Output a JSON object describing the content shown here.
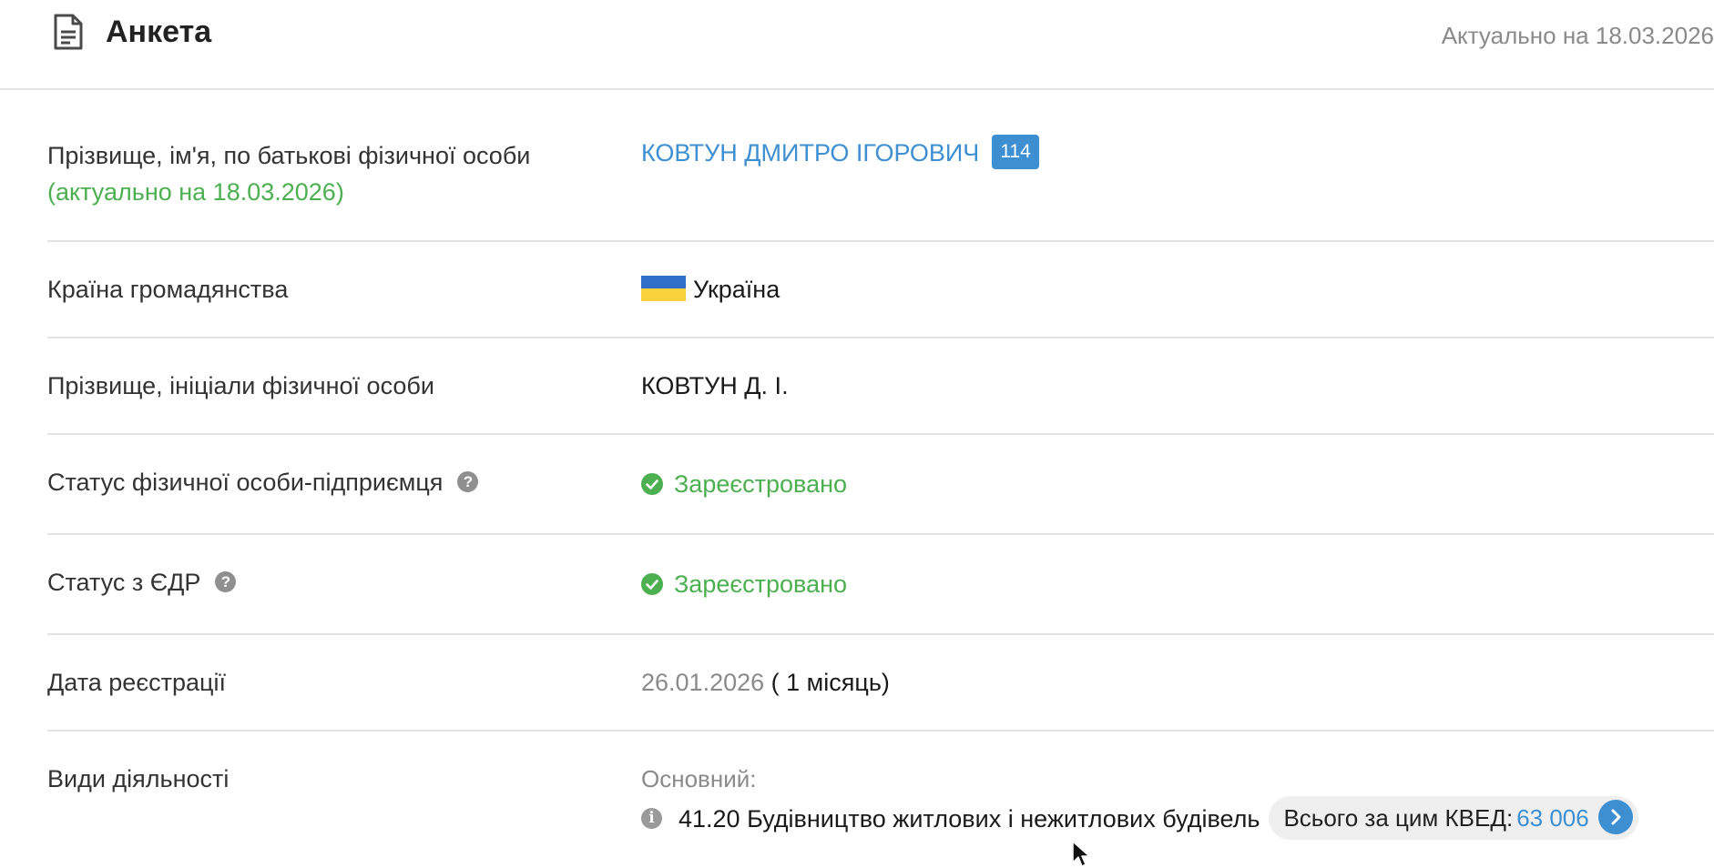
{
  "header": {
    "title": "Анкета",
    "actual_date": "Актуально на 18.03.2026"
  },
  "rows": {
    "full_name": {
      "label": "Прізвище, ім'я, по батькові фізичної особи",
      "label_note": "(актуально на 18.03.2026)",
      "value": "КОВТУН ДМИТРО ІГОРОВИЧ",
      "badge": "114"
    },
    "citizenship": {
      "label": "Країна громадянства",
      "value": "Україна"
    },
    "initials": {
      "label": "Прізвище, ініціали фізичної особи",
      "value": "КОВТУН Д. І."
    },
    "fop_status": {
      "label": "Статус фізичної особи-підприємця",
      "value": "Зареєстровано"
    },
    "edr_status": {
      "label": "Статус з ЄДР",
      "value": "Зареєстровано"
    },
    "registration_date": {
      "label": "Дата реєстрації",
      "date": "26.01.2026",
      "duration": "( 1 місяць)"
    },
    "activities": {
      "label": "Види діяльності",
      "main_label": "Основний:",
      "kved": "41.20 Будівництво житлових і нежитлових будівель",
      "total_label": "Всього за цим КВЕД:",
      "total_value": "63 006"
    }
  },
  "colors": {
    "link": "#3d8fd1",
    "green": "#4caf50",
    "gray_text": "#8a8a8a",
    "divider": "#e3e3e3",
    "flag_blue": "#2f6ec9",
    "flag_yellow": "#f8d23a"
  },
  "icons": {
    "doc": "document-icon",
    "help": "question-circle-icon",
    "check": "check-circle-icon",
    "info": "info-circle-icon",
    "arrow": "chevron-right-icon",
    "flag": "ukraine-flag-icon"
  }
}
